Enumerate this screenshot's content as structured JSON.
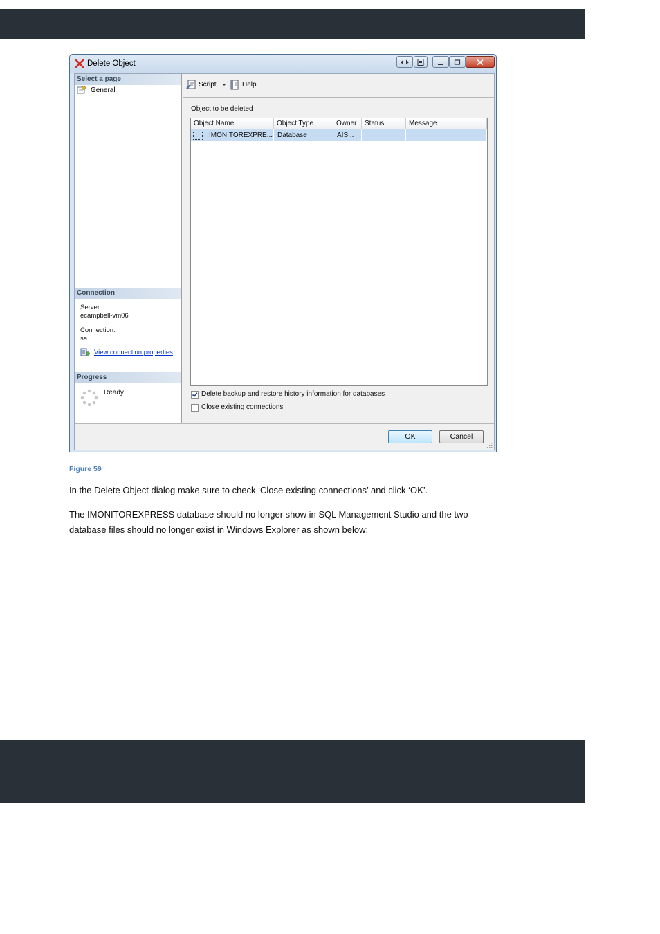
{
  "dialog": {
    "title": "Delete Object",
    "left": {
      "select_page_header": "Select a page",
      "page_general": "General",
      "connection_header": "Connection",
      "server_label": "Server:",
      "server_value": "ecampbell-vm06",
      "connection_label": "Connection:",
      "connection_value": "sa",
      "view_connection_link": "View connection properties",
      "progress_header": "Progress",
      "progress_status": "Ready"
    },
    "toolbar": {
      "script_label": "Script",
      "help_label": "Help"
    },
    "objects_label": "Object to be deleted",
    "grid": {
      "columns": [
        "Object Name",
        "Object Type",
        "Owner",
        "Status",
        "Message"
      ],
      "rows": [
        [
          "IMONITOREXPRE...",
          "Database",
          "AIS...",
          "",
          ""
        ]
      ]
    },
    "options": [
      {
        "label": "Delete backup and restore history information for databases",
        "checked": true
      },
      {
        "label": "Close existing connections",
        "checked": false
      }
    ],
    "ok_label": "OK",
    "cancel_label": "Cancel"
  },
  "document": {
    "caption": "Figure 59",
    "paragraph1": "In the Delete Object dialog make sure to check ‘Close existing connections’ and click ‘OK’.",
    "paragraph2": "The IMONITOREXPRESS database should no longer show in SQL Management Studio and the two database files should no longer exist in Windows Explorer as shown below:"
  },
  "colors": {
    "header_band": "#2a3038",
    "caption": "#4f81bd",
    "selected_row": "#c5dcf2"
  }
}
